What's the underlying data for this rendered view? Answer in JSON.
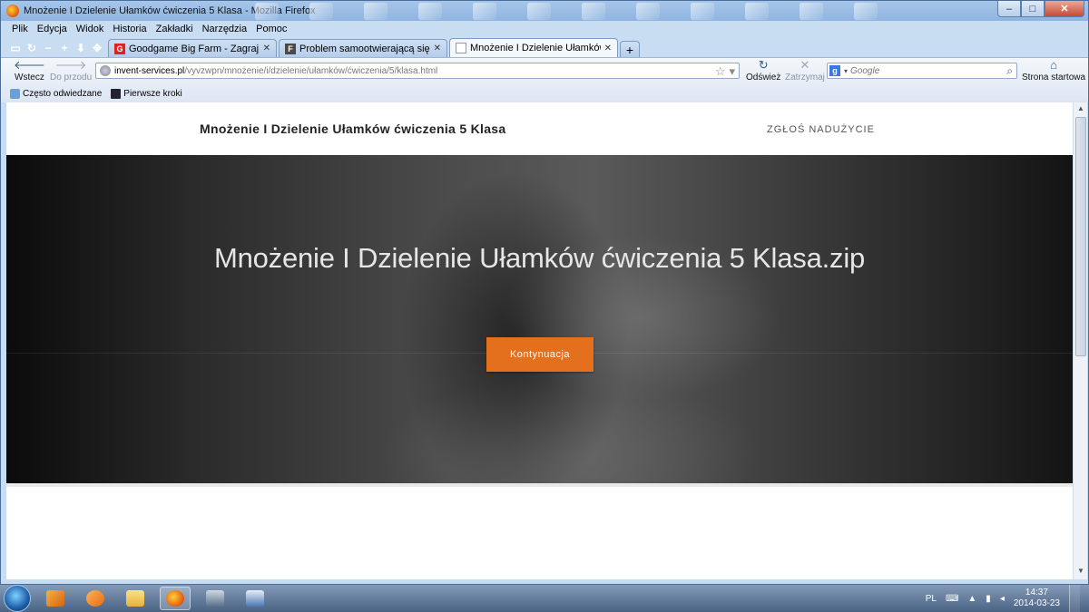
{
  "window": {
    "title": "Mnożenie I Dzielenie Ułamków ćwiczenia 5 Klasa - Mozilla Firefox",
    "min_label": "–",
    "max_label": "□",
    "close_label": "✕"
  },
  "menu": [
    "Plik",
    "Edycja",
    "Widok",
    "Historia",
    "Zakładki",
    "Narzędzia",
    "Pomoc"
  ],
  "tabs": [
    {
      "label": "Goodgame Big Farm - Zagraj w darm...",
      "favicon": "G",
      "favicon_color": "#d9241f",
      "active": false
    },
    {
      "label": "Problem samootwierającą się www/s...",
      "favicon": "F",
      "favicon_color": "#4a4a4a",
      "active": false
    },
    {
      "label": "Mnożenie I Dzielenie Ułamków ćwicz...",
      "favicon": "",
      "favicon_color": "#ffffff",
      "active": true
    }
  ],
  "new_tab_label": "+",
  "nav": {
    "back": "Wstecz",
    "forward": "Do przodu",
    "reload": "Odśwież",
    "stop": "Zatrzymaj",
    "home": "Strona startowa",
    "url_host": "invent-services.pl",
    "url_path": "/vyvzwpn/mnożenie/i/dzielenie/ułamków/ćwiczenia/5/klasa.html",
    "search_placeholder": "Google"
  },
  "bookmarks": [
    "Często odwiedzane",
    "Pierwsze kroki"
  ],
  "page": {
    "site_title": "Mnożenie I Dzielenie Ułamków ćwiczenia 5 Klasa",
    "report_link": "ZGŁOŚ NADUŻYCIE",
    "hero_title": "Mnożenie I Dzielenie Ułamków ćwiczenia 5 Klasa.zip",
    "cta": "Kontynuacja",
    "cta_color": "#e4701e"
  },
  "taskbar": {
    "apps": [
      "windows-explorer",
      "media-player",
      "folder",
      "firefox",
      "terminal",
      "remote-desktop"
    ],
    "lang": "PL",
    "time": "14:37",
    "date": "2014-03-23"
  }
}
